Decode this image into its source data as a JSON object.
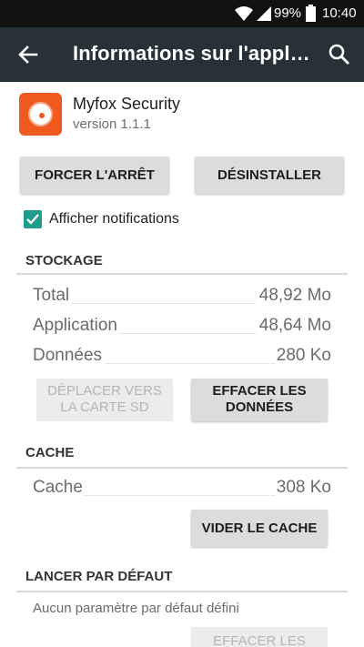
{
  "status_bar": {
    "battery_pct": "99%",
    "clock": "10:40",
    "icons": [
      "wifi-icon",
      "signal-icon",
      "battery-icon"
    ]
  },
  "app_bar": {
    "title": "Informations sur l'application",
    "icons": [
      "back-arrow-icon",
      "search-icon"
    ]
  },
  "app": {
    "name": "Myfox Security",
    "version": "version 1.1.1",
    "icon": "myfox-app-icon",
    "icon_color": "#ef5a1f"
  },
  "actions": {
    "force_stop": "FORCER L'ARRÊT",
    "uninstall": "DÉSINSTALLER"
  },
  "notifications": {
    "label": "Afficher notifications",
    "checked": true,
    "accent": "#1f9c8b"
  },
  "storage": {
    "header": "STOCKAGE",
    "rows": [
      {
        "label": "Total",
        "value": "48,92 Mo"
      },
      {
        "label": "Application",
        "value": "48,64 Mo"
      },
      {
        "label": "Données",
        "value": "280 Ko"
      }
    ],
    "move_to_sd": [
      "DÉPLACER VERS",
      "LA CARTE SD"
    ],
    "clear_data": [
      "EFFACER LES",
      "DONNÉES"
    ]
  },
  "cache": {
    "header": "CACHE",
    "label": "Cache",
    "value": "308 Ko",
    "clear_cache": "VIDER LE CACHE"
  },
  "defaults": {
    "header": "LANCER PAR DÉFAUT",
    "text": "Aucun paramètre par défaut défini",
    "clear_defaults": "EFFACER LES"
  },
  "colors": {
    "app_bar": "#263238",
    "status_bar": "#111111"
  }
}
